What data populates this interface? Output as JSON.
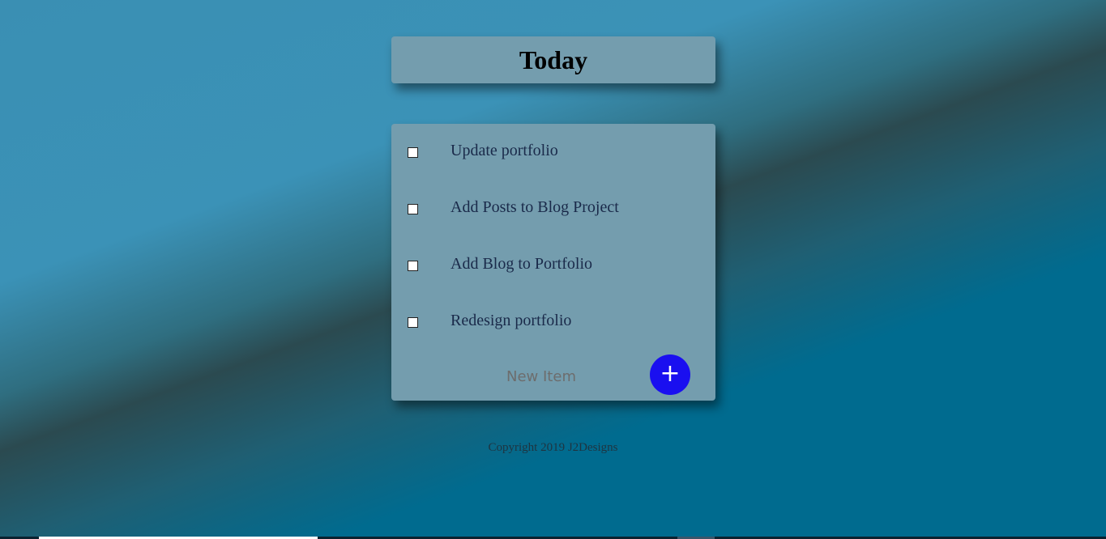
{
  "header": {
    "title": "Today"
  },
  "todo": {
    "items": [
      {
        "label": "Update portfolio",
        "checked": false
      },
      {
        "label": "Add Posts to Blog Project",
        "checked": false
      },
      {
        "label": "Add Blog to Portfolio",
        "checked": false
      },
      {
        "label": "Redesign portfolio",
        "checked": false
      }
    ],
    "new_item_placeholder": "New Item",
    "add_button_label": "+"
  },
  "footer": {
    "text": "Copyright 2019 J2Designs"
  },
  "colors": {
    "card": "#749dae",
    "add_button": "#1a0ff0",
    "item_text": "#1a2a4a"
  }
}
